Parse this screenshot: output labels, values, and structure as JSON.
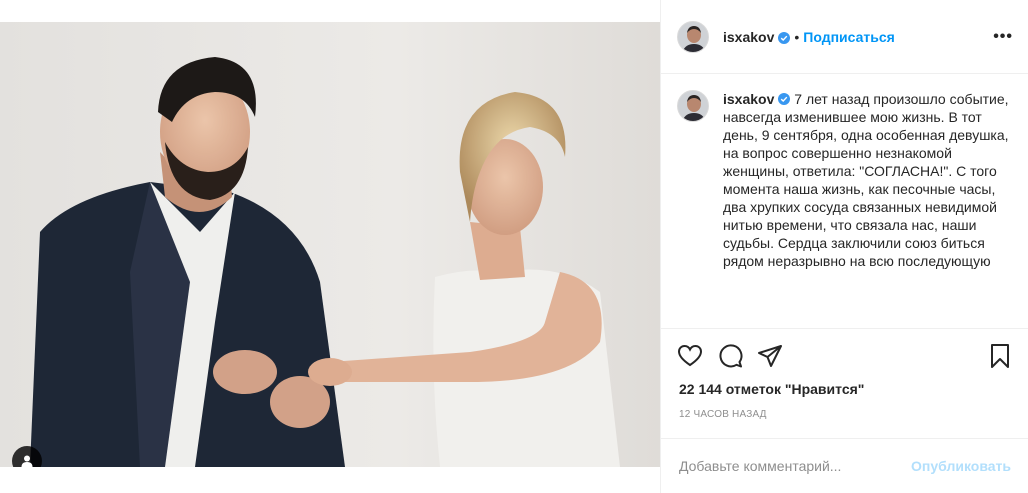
{
  "header": {
    "username": "isxakov",
    "separator": "•",
    "follow_label": "Подписаться",
    "more_label": "•••"
  },
  "caption": {
    "username": "isxakov",
    "text": "7 лет назад произошло событие, навсегда изменившее мою жизнь. В тот день, 9 сентября, одна особенная девушка, на вопрос совершенно незнакомой женщины, ответила: \"СОГЛАСНА!\". С того момента наша жизнь, как песочные часы, два хрупких сосуда связанных невидимой нитью времени, что связала нас, наши судьбы. Сердца заключили союз биться рядом неразрывно на всю последующую"
  },
  "engagement": {
    "likes": "22 144 отметок \"Нравится\"",
    "time": "12 часов назад"
  },
  "comment_box": {
    "placeholder": "Добавьте комментарий...",
    "post_label": "Опубликовать"
  },
  "icons": {
    "like": "heart-icon",
    "comment": "comment-icon",
    "share": "share-icon",
    "save": "bookmark-icon",
    "tag": "user-tag-icon",
    "verified": "verified-badge-icon"
  },
  "colors": {
    "accent": "#0095f6",
    "post_disabled": "#b2dffc",
    "muted": "#8e8e8e",
    "text": "#262626",
    "verified": "#3897f0"
  }
}
